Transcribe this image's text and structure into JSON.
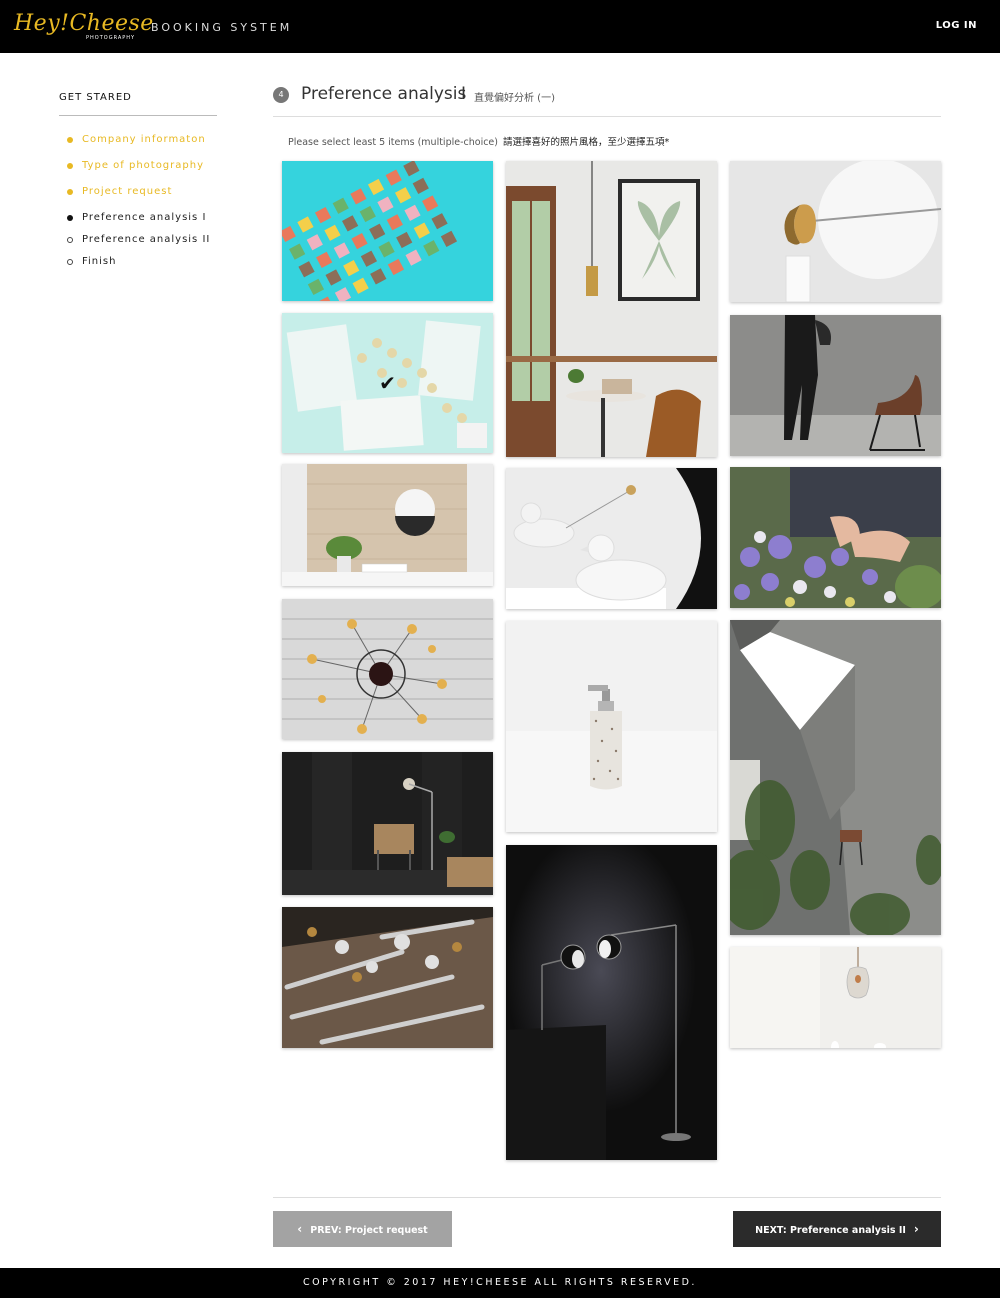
{
  "header": {
    "logo_text": "Hey!Cheese",
    "logo_sub": "PHOTOGRAPHY",
    "brand_title": "BOOKING SYSTEM",
    "login_label": "LOG IN"
  },
  "sidebar": {
    "title": "GET STARED",
    "steps": [
      {
        "label": "Company informaton",
        "status": "done"
      },
      {
        "label": "Type of photography",
        "status": "done"
      },
      {
        "label": "Project request",
        "status": "done"
      },
      {
        "label": "Preference analysis I",
        "status": "current"
      },
      {
        "label": "Preference analysis II",
        "status": "todo"
      },
      {
        "label": "Finish",
        "status": "todo"
      }
    ]
  },
  "main": {
    "step_number": "4",
    "title": "Preference analysis",
    "title_separator": "I",
    "title_zh": "直覺偏好分析 (一)",
    "instructions": "Please select least 5 items (multiple-choice)",
    "instructions_zh": "請選擇喜好的照片風格，至少選擇五項*",
    "selected_mark": "✔"
  },
  "navigation": {
    "prev_label": "PREV: Project request",
    "next_label": "NEXT: Preference analysis II",
    "prev_chevron": "‹",
    "next_chevron": "›"
  },
  "footer": {
    "copyright": "COPYRIGHT © 2017 HEY!CHEESE ALL RIGHTS RESERVED."
  },
  "colors": {
    "accent": "#e8b923",
    "header_bg": "#000000",
    "next_button": "#2b2b2b",
    "prev_button": "#a3a3a3"
  }
}
